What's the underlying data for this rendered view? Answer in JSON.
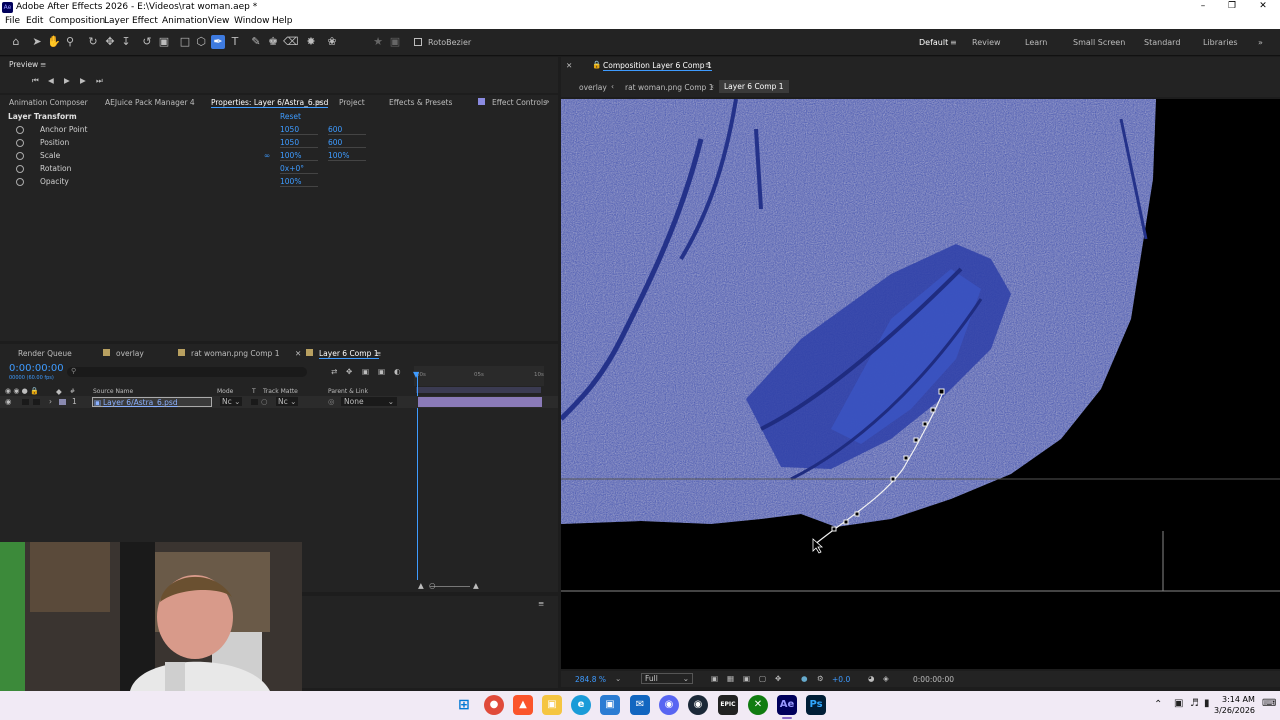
{
  "window": {
    "title": "Adobe After Effects 2026 - E:\\Videos\\rat woman.aep *",
    "app_icon": "Ae"
  },
  "menu": [
    "File",
    "Edit",
    "Composition",
    "Layer",
    "Effect",
    "Animation",
    "View",
    "Window",
    "Help"
  ],
  "toolbar": {
    "rotobezier_label": "RotoBezier",
    "workspaces": [
      "Default",
      "Review",
      "Learn",
      "Small Screen",
      "Standard",
      "Libraries"
    ],
    "active_workspace": "Default"
  },
  "preview": {
    "title": "Preview"
  },
  "panel_tabs": [
    "Animation Composer",
    "AEJuice Pack Manager 4",
    "Properties: Layer 6/Astra_6.psd",
    "Project",
    "Effects & Presets",
    "Effect Controls"
  ],
  "properties": {
    "section": "Layer Transform",
    "reset": "Reset",
    "rows": [
      {
        "label": "Anchor Point",
        "v1": "1050",
        "v2": "600"
      },
      {
        "label": "Position",
        "v1": "1050",
        "v2": "600"
      },
      {
        "label": "Scale",
        "v1": "100%",
        "v2": "100%"
      },
      {
        "label": "Rotation",
        "v1": "0x+0°",
        "v2": ""
      },
      {
        "label": "Opacity",
        "v1": "100%",
        "v2": ""
      }
    ]
  },
  "timeline": {
    "tabs": [
      "Render Queue",
      "overlay",
      "rat woman.png Comp 1",
      "Layer 6 Comp 1"
    ],
    "timecode": "0:00:00:00",
    "fps": "00000 (60.00 fps)",
    "columns": {
      "source": "Source Name",
      "mode": "Mode",
      "t": "T",
      "trackmatte": "Track Matte",
      "parent": "Parent & Link"
    },
    "ruler": [
      "00s",
      "05s",
      "10s"
    ],
    "layer": {
      "num": "1",
      "name": "Layer 6/Astra_6.psd",
      "mode": "Nc",
      "matte": "Nc",
      "parent": "None"
    }
  },
  "composition": {
    "title": "Composition Layer 6 Comp 1",
    "breadcrumbs": [
      "overlay",
      "rat woman.png Comp 1",
      "Layer 6 Comp 1"
    ],
    "zoom": "284.8 %",
    "resolution": "Full",
    "exposure": "+0.0",
    "timecode": "0:00:00:00"
  },
  "taskbar": {
    "time": "3:14 AM",
    "date": "3/26/2026"
  },
  "colors": {
    "accent": "#3e9bff",
    "panel": "#232323",
    "artwork": "#3a4fb0"
  }
}
